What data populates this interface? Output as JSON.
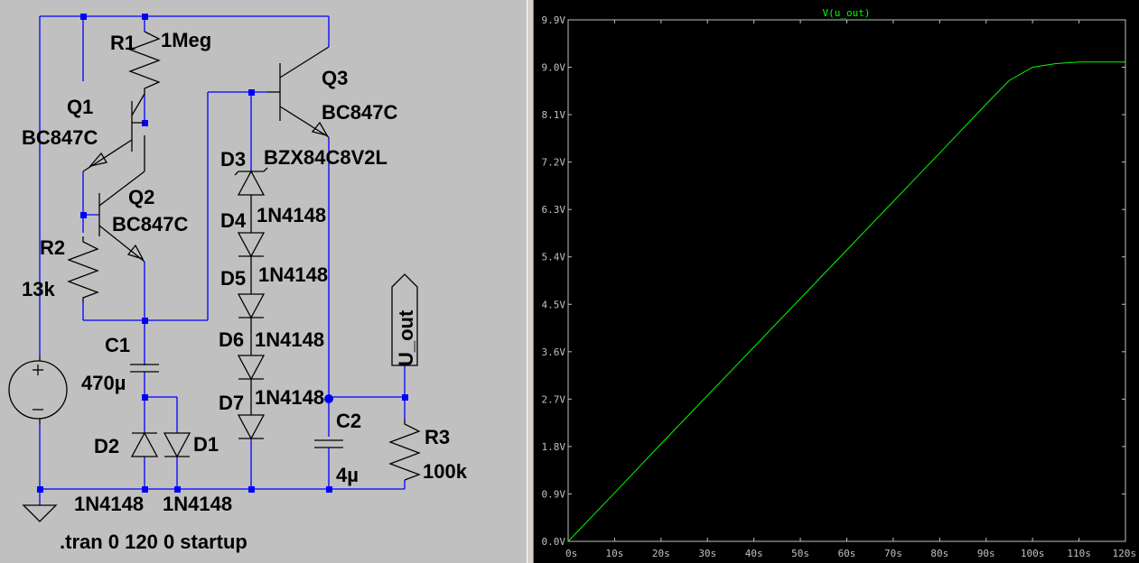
{
  "schematic": {
    "components": {
      "R1": {
        "ref": "R1",
        "value": "1Meg"
      },
      "R2": {
        "ref": "R2",
        "value": "13k"
      },
      "R3": {
        "ref": "R3",
        "value": "100k"
      },
      "Q1": {
        "ref": "Q1",
        "value": "BC847C"
      },
      "Q2": {
        "ref": "Q2",
        "value": "BC847C"
      },
      "Q3": {
        "ref": "Q3",
        "value": "BC847C"
      },
      "C1": {
        "ref": "C1",
        "value": "470µ"
      },
      "C2": {
        "ref": "C2",
        "value": "4µ"
      },
      "D1": {
        "ref": "D1",
        "value": "1N4148"
      },
      "D2": {
        "ref": "D2",
        "value": "1N4148"
      },
      "D3": {
        "ref": "D3",
        "value": "BZX84C8V2L"
      },
      "D4": {
        "ref": "D4",
        "value": "1N4148"
      },
      "D5": {
        "ref": "D5",
        "value": "1N4148"
      },
      "D6": {
        "ref": "D6",
        "value": "1N4148"
      },
      "D7": {
        "ref": "D7",
        "value": "1N4148"
      }
    },
    "net_label": "U_out",
    "directive": ".tran 0 120 0 startup",
    "colors": {
      "background": "#c0c0c0",
      "wire": "#0000ff",
      "component": "#000000"
    }
  },
  "plot": {
    "title": "V(u_out)",
    "colors": {
      "background": "#000000",
      "trace": "#00ff00",
      "axis": "#c0c0c0"
    }
  },
  "chart_data": {
    "type": "line",
    "title": "V(u_out)",
    "xlabel": "",
    "ylabel": "",
    "xlim": [
      0,
      120
    ],
    "ylim": [
      0,
      9.9
    ],
    "x_ticks": [
      "0s",
      "10s",
      "20s",
      "30s",
      "40s",
      "50s",
      "60s",
      "70s",
      "80s",
      "90s",
      "100s",
      "110s",
      "120s"
    ],
    "y_ticks": [
      "0.0V",
      "0.9V",
      "1.8V",
      "2.7V",
      "3.6V",
      "4.5V",
      "5.4V",
      "6.3V",
      "7.2V",
      "8.1V",
      "9.0V",
      "9.9V"
    ],
    "grid": false,
    "series": [
      {
        "x": [
          0,
          10,
          20,
          30,
          40,
          50,
          60,
          70,
          80,
          90,
          95,
          100,
          105,
          110,
          120
        ],
        "y": [
          0,
          0.92,
          1.85,
          2.77,
          3.69,
          4.61,
          5.53,
          6.45,
          7.37,
          8.3,
          8.75,
          9.0,
          9.07,
          9.1,
          9.1
        ]
      }
    ]
  }
}
